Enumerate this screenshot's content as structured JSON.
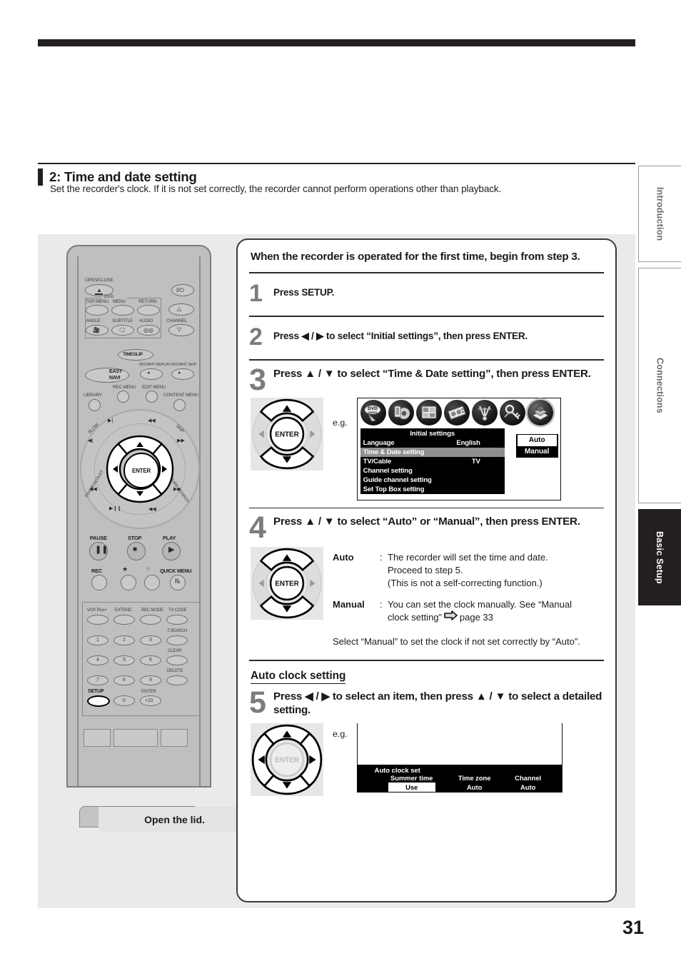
{
  "document": {
    "page_number": "31"
  },
  "section": {
    "heading": "2: Time and date setting",
    "intro": "Set the recorder's clock. If it is not set correctly, the recorder cannot perform operations other than playback."
  },
  "side_tabs": [
    {
      "label": "Introduction",
      "active": false
    },
    {
      "label": "Connections",
      "active": false
    },
    {
      "label": "Basic Setup",
      "active": true
    }
  ],
  "remote": {
    "caption": "Open the lid.",
    "labels": {
      "open_close": "OPEN/CLOSE",
      "power": "I/⏻",
      "dvd": "DVD",
      "top_menu": "TOP MENU",
      "menu": "MENU",
      "return": "RETURN",
      "angle": "ANGLE",
      "subtitle": "SUBTITLE",
      "audio": "AUDIO",
      "channel": "CHANNEL",
      "timeslip": "TIMESLIP",
      "easy_navi": "EASY NAVI",
      "instant_replay": "INSTANT REPLAY",
      "instant_skip": "INSTANT SKIP",
      "rec_menu": "REC MENU",
      "edit_menu": "EDIT MENU",
      "library": "LIBRARY",
      "content_menu": "CONTENT MENU",
      "slow": "SLOW",
      "skip": "SKIP",
      "frame_adjust": "FRAME/ADJUST",
      "picture_search": "PICTURE SEARCH",
      "enter": "ENTER",
      "pause": "PAUSE",
      "stop": "STOP",
      "play": "PLAY",
      "rec": "REC",
      "quick_menu": "QUICK MENU",
      "vcr_plus": "VCR Plus+",
      "extend": "EXTEND",
      "rec_mode": "REC MODE",
      "tv_code": "TV CODE",
      "t_search": "T.SEARCH",
      "clear": "CLEAR",
      "delete": "DELETE",
      "setup": "SETUP",
      "enter_key": "ENTER",
      "plus10": "+10",
      "num0": "0",
      "num1": "1",
      "num2": "2",
      "num3": "3",
      "num4": "4",
      "num5": "5",
      "num6": "6",
      "num7": "7",
      "num8": "8",
      "num9": "9"
    }
  },
  "steps_card": {
    "lead_note": "When the recorder is operated for the first time, begin from step 3.",
    "eg_label": "e.g.",
    "steps": [
      {
        "number": "1",
        "title": "Press SETUP."
      },
      {
        "number": "2",
        "title": "Press ◀ / ▶ to select “Initial settings”, then press ENTER."
      },
      {
        "number": "3",
        "title": "Press ▲ / ▼ to select “Time & Date setting”, then press ENTER."
      },
      {
        "number": "4",
        "title": "Press ▲ / ▼ to select “Auto” or “Manual”, then press ENTER."
      },
      {
        "number": "5",
        "title": "Press ◀ / ▶ to select an item, then press ▲ / ▼ to select a detailed setting."
      }
    ],
    "step4_definitions": [
      {
        "term": "Auto",
        "colon": ":",
        "lines": [
          "The recorder will set the time and date.",
          "Proceed to step 5.",
          "(This is not a self-correcting function.)"
        ]
      },
      {
        "term": "Manual",
        "colon": ":",
        "lines": [
          "You can set the clock manually. See “Manual",
          "clock setting”"
        ],
        "ref_icon": "right-arrow-icon",
        "ref_text": "page 33"
      }
    ],
    "step4_note": "Select “Manual” to set the clock if not set correctly by “Auto”.",
    "auto_clock_heading": "Auto clock setting"
  },
  "osd_initial_settings": {
    "icons": [
      "dvd-video-icon",
      "audio-speaker-icon",
      "display-grid-icon",
      "recording-deck-icon",
      "antenna-tuner-icon",
      "key-tools-icon",
      "initial-settings-book-icon"
    ],
    "selected_icon_index": 6,
    "title": "Initial settings",
    "rows": [
      {
        "label": "Language",
        "value": "English",
        "highlighted": false
      },
      {
        "label": "Time & Date setting",
        "value": "",
        "highlighted": true
      },
      {
        "label": "TV/Cable",
        "value": "TV",
        "highlighted": false
      },
      {
        "label": "Channel setting",
        "value": "",
        "highlighted": false
      },
      {
        "label": "Guide channel setting",
        "value": "",
        "highlighted": false
      },
      {
        "label": "Set Top Box setting",
        "value": "",
        "highlighted": false
      }
    ],
    "submenu": {
      "options": [
        {
          "label": "Auto",
          "selected": true
        },
        {
          "label": "Manual",
          "selected": false
        }
      ]
    }
  },
  "osd_auto_clock": {
    "title": "Auto clock set",
    "columns": [
      {
        "header": "Summer time",
        "value": "Use",
        "highlighted": true
      },
      {
        "header": "Time zone",
        "value": "Auto",
        "highlighted": false
      },
      {
        "header": "Channel",
        "value": "Auto",
        "highlighted": false
      }
    ]
  }
}
